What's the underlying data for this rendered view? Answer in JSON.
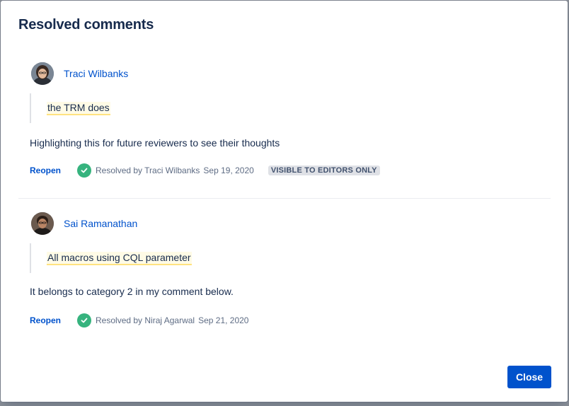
{
  "dialog": {
    "title": "Resolved comments",
    "close_label": "Close"
  },
  "comments": [
    {
      "author": "Traci Wilbanks",
      "quote": "the TRM does",
      "body": "Highlighting this for future reviewers to see their thoughts",
      "reopen_label": "Reopen",
      "resolved_by": "Resolved by Traci Wilbanks",
      "resolved_date": "Sep 19, 2020",
      "visibility_badge": "VISIBLE TO EDITORS ONLY"
    },
    {
      "author": "Sai Ramanathan",
      "quote": "All macros using CQL parameter",
      "body": "It belongs to category 2 in my comment below.",
      "reopen_label": "Reopen",
      "resolved_by": "Resolved by Niraj Agarwal",
      "resolved_date": "Sep 21, 2020"
    }
  ],
  "colors": {
    "link": "#0052cc",
    "resolved_check": "#36b37e",
    "highlight_bg": "#fffbe6",
    "highlight_underline": "#ffe380",
    "primary_button": "#0052cc"
  },
  "icons": {
    "resolved": "check-circle-icon"
  }
}
